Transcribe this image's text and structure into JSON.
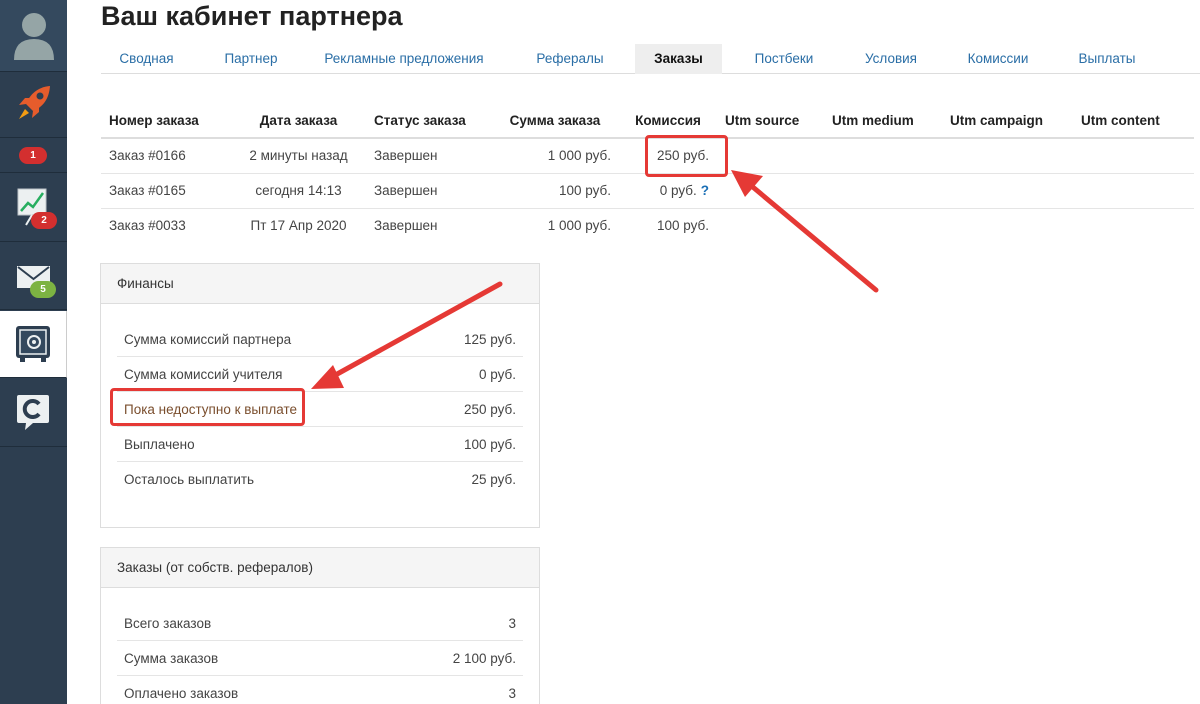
{
  "sidebar": {
    "badges": {
      "rocket": "1",
      "chart": "2",
      "mail": "5"
    },
    "colors": {
      "rocket": "#e65c2c",
      "badge_red": "#d32f2f",
      "badge_green": "#7cb342"
    }
  },
  "page": {
    "title": "Ваш кабинет партнера"
  },
  "tabs": [
    {
      "label": "Сводная",
      "active": false
    },
    {
      "label": "Партнер",
      "active": false
    },
    {
      "label": "Рекламные предложения",
      "active": false
    },
    {
      "label": "Рефералы",
      "active": false
    },
    {
      "label": "Заказы",
      "active": true
    },
    {
      "label": "Постбеки",
      "active": false
    },
    {
      "label": "Условия",
      "active": false
    },
    {
      "label": "Комиссии",
      "active": false
    },
    {
      "label": "Выплаты",
      "active": false
    }
  ],
  "orders": {
    "headers": [
      "Номер заказа",
      "Дата заказа",
      "Статус заказа",
      "Сумма заказа",
      "Комиссия",
      "Utm source",
      "Utm medium",
      "Utm campaign",
      "Utm content"
    ],
    "rows": [
      {
        "number": "Заказ #0166",
        "date": "2 минуты назад",
        "status": "Завершен",
        "sum": "1 000 руб.",
        "commission": "250 руб.",
        "help": ""
      },
      {
        "number": "Заказ #0165",
        "date": "сегодня 14:13",
        "status": "Завершен",
        "sum": "100 руб.",
        "commission": "0 руб.",
        "help": "?"
      },
      {
        "number": "Заказ #0033",
        "date": "Пт 17 Апр 2020",
        "status": "Завершен",
        "sum": "1 000 руб.",
        "commission": "100 руб.",
        "help": ""
      }
    ]
  },
  "finances": {
    "title": "Финансы",
    "rows": [
      {
        "label": "Сумма комиссий партнера",
        "value": "125 руб."
      },
      {
        "label": "Сумма комиссий учителя",
        "value": "0 руб."
      },
      {
        "label": "Пока недоступно к выплате",
        "value": "250 руб."
      },
      {
        "label": "Выплачено",
        "value": "100 руб."
      },
      {
        "label": "Осталось выплатить",
        "value": "25 руб."
      }
    ]
  },
  "ref_orders": {
    "title": "Заказы (от собств. рефералов)",
    "rows": [
      {
        "label": "Всего заказов",
        "value": "3"
      },
      {
        "label": "Сумма заказов",
        "value": "2 100 руб."
      },
      {
        "label": "Оплачено заказов",
        "value": "3"
      }
    ]
  },
  "annotation_color": "#e53935"
}
